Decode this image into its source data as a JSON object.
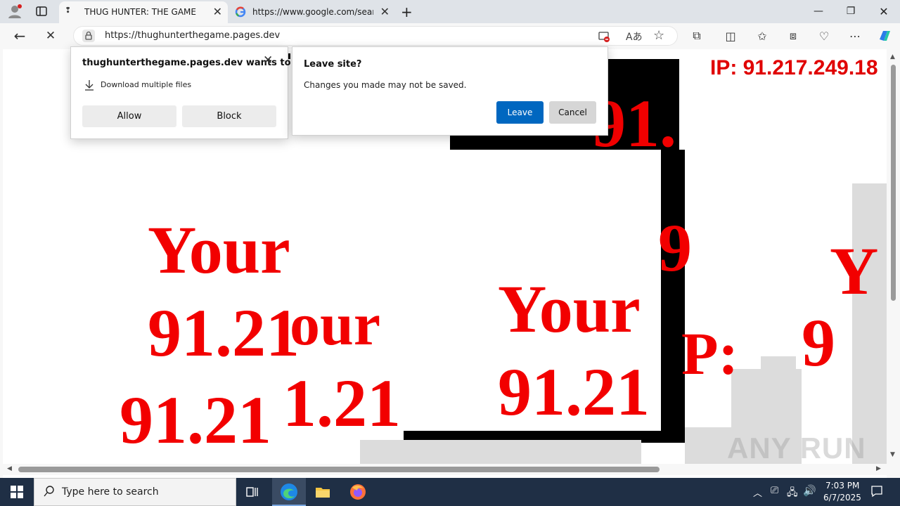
{
  "browser": {
    "tabs": [
      {
        "label": "THUG HUNTER: THE GAME",
        "active": true
      },
      {
        "label": "https://www.google.com/search",
        "active": false
      }
    ],
    "url": "https://thughunterthegame.pages.dev"
  },
  "page": {
    "ip_label": "IP: 91.217.249.18",
    "texts": {
      "your": "Your",
      "our": "our",
      "ip_frag_1": "91.21",
      "ip_frag_2": "1.21",
      "ip_frag_3": "91.21",
      "ip_frag_4": "91.",
      "ip_frag_5": "9",
      "ip_frag_6": "P:",
      "ip_frag_7": "9",
      "your_small": "Y"
    }
  },
  "download_prompt": {
    "title": "thughunterthegame.pages.dev wants to",
    "item": "Download multiple files",
    "allow": "Allow",
    "block": "Block"
  },
  "leave_dialog": {
    "title": "Leave site?",
    "message": "Changes you made may not be saved.",
    "leave": "Leave",
    "cancel": "Cancel"
  },
  "taskbar": {
    "search_placeholder": "Type here to search",
    "time": "7:03 PM",
    "date": "6/7/2025"
  },
  "watermark": "ANY RUN",
  "colors": {
    "accent": "#0067c0",
    "page_red": "#f20000",
    "taskbar": "#1f2f45"
  }
}
